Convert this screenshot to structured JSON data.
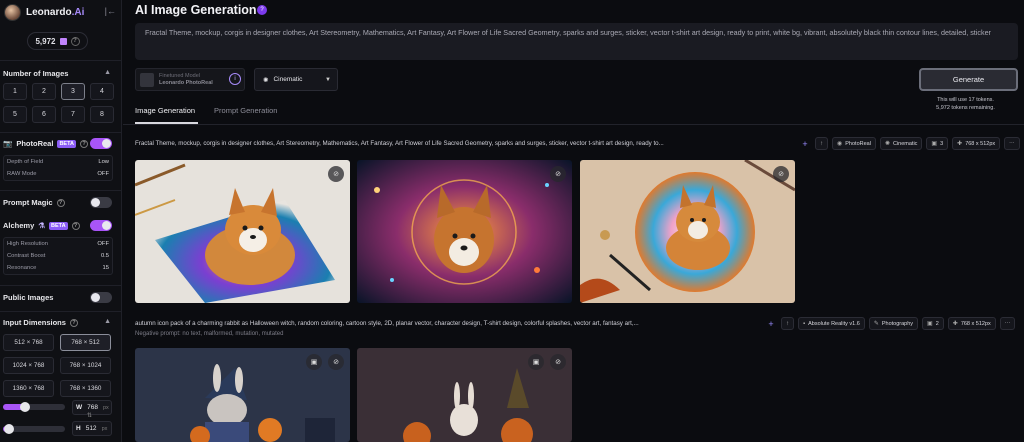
{
  "brand": {
    "name": "Leonardo",
    "suffix": ".Ai"
  },
  "tokens": {
    "count": "5,972"
  },
  "sidebar": {
    "number_of_images": {
      "label": "Number of Images",
      "options": [
        "1",
        "2",
        "3",
        "4",
        "5",
        "6",
        "7",
        "8"
      ],
      "selected": "3"
    },
    "photoreal": {
      "label": "PhotoReal",
      "badge": "BETA",
      "enabled": true,
      "settings": [
        {
          "name": "Depth of Field",
          "value": "Low"
        },
        {
          "name": "RAW Mode",
          "value": "OFF"
        }
      ]
    },
    "prompt_magic": {
      "label": "Prompt Magic",
      "enabled": false
    },
    "alchemy": {
      "label": "Alchemy",
      "badge": "BETA",
      "enabled": true,
      "settings": [
        {
          "name": "High Resolution",
          "value": "OFF"
        },
        {
          "name": "Contrast Boost",
          "value": "0.5"
        },
        {
          "name": "Resonance",
          "value": "15"
        }
      ]
    },
    "public_images": {
      "label": "Public Images",
      "enabled": false
    },
    "input_dimensions": {
      "label": "Input Dimensions",
      "options": [
        "512 × 768",
        "768 × 512",
        "1024 × 768",
        "768 × 1024",
        "1360 × 768",
        "768 × 1360"
      ],
      "selected": "768 × 512"
    },
    "width": {
      "label": "W",
      "value": "768",
      "unit": "px"
    },
    "height": {
      "label": "H",
      "value": "512",
      "unit": "px"
    },
    "width_slider_fraction": 0.35,
    "height_slider_fraction": 0.1
  },
  "main": {
    "title": "AI Image Generation",
    "prompt": "Fractal Theme, mockup, corgis in designer clothes, Art Stereometry, Mathematics, Art Fantasy, Art Flower of Life Sacred Geometry, sparks and surges, sticker, vector t-shirt art design, ready to print, white bg, vibrant, absolutely black thin contour lines, detailed, sticker",
    "model": {
      "label": "Finetuned Model",
      "name": "Leonardo PhotoReal"
    },
    "style": "Cinematic",
    "generate_label": "Generate",
    "generate_note_1": "This will use 17 tokens.",
    "generate_note_2": "5,972 tokens remaining.",
    "tabs": [
      "Image Generation",
      "Prompt Generation"
    ],
    "generations": [
      {
        "prompt": "Fractal Theme, mockup, corgis in designer clothes, Art Stereometry, Mathematics, Art Fantasy, Art Flower of Life Sacred Geometry, sparks and surges, sticker, vector t-shirt art design, ready to...",
        "model": "PhotoReal",
        "style": "Cinematic",
        "count": "3",
        "size": "768 x 512px"
      },
      {
        "prompt": "autumn icon pack of a charming rabbit as Halloween witch, random coloring, cartoon style, 2D, planar vector, character design, T-shirt design, colorful splashes, vector art, fantasy art,...",
        "negative": "Negative prompt: no text, malformed, mutation, mutated",
        "model": "Absolute Reality v1.6",
        "style": "Photography",
        "count": "2",
        "size": "768 x 512px"
      }
    ]
  },
  "colors": {
    "accent": "#a855f7",
    "background": "#0b0c10"
  }
}
